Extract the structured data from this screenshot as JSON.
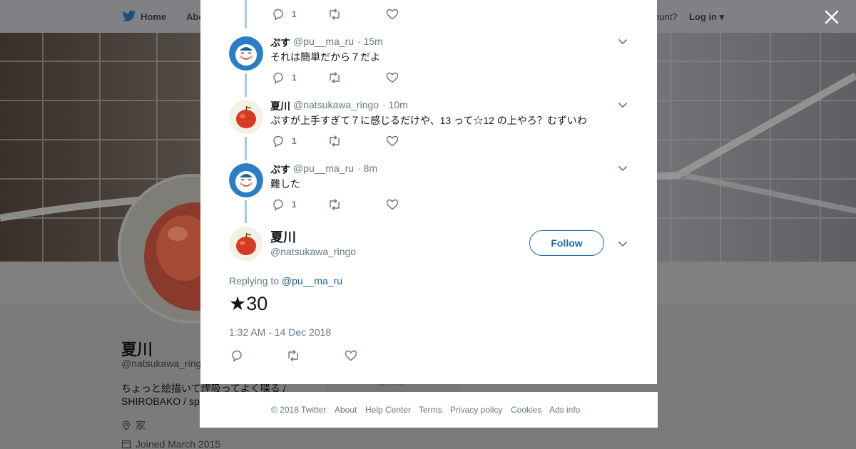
{
  "background": {
    "nav": {
      "home_label": "Home",
      "about_label": "Abo",
      "account_prompt": "ccount?",
      "login_label": "Log in"
    },
    "profile": {
      "name": "夏川",
      "handle": "@natsukawa_ringo",
      "bio_line1": "ちょっと絵描いて煙吸ってよく喋る /",
      "bio_line2": "SHIROBAKO / sp",
      "location": "家",
      "joined": "Joined March 2015",
      "ads_label": "Ads info"
    }
  },
  "modal": {
    "top_reply_count": "1",
    "tweets": [
      {
        "name": "ぷす",
        "handle": "@pu__ma_ru",
        "time": "· 15m",
        "text": "それは簡単だから７だよ",
        "reply_count": "1"
      },
      {
        "name": "夏川",
        "handle": "@natsukawa_ringo",
        "time": "· 10m",
        "text": "ぷすが上手すぎて７に感じるだけや、13 って☆12 の上やろ？むずいわ",
        "reply_count": "1"
      },
      {
        "name": "ぷす",
        "handle": "@pu__ma_ru",
        "time": "· 8m",
        "text": "難した",
        "reply_count": "1"
      }
    ],
    "main_tweet": {
      "name": "夏川",
      "handle": "@natsukawa_ringo",
      "follow_label": "Follow",
      "replying_prefix": "Replying to",
      "replying_handle": "@pu__ma_ru",
      "text": "★30",
      "timestamp": "1:32 AM - 14 Dec 2018"
    }
  },
  "footer": {
    "links": [
      "© 2018 Twitter",
      "About",
      "Help Center",
      "Terms",
      "Privacy policy",
      "Cookies",
      "Ads info"
    ]
  },
  "colors": {
    "accent": "#1d6da8",
    "thread_line": "#a2c9e8",
    "muted_text": "#657786",
    "overlay_bg": "#7d7d7d"
  }
}
